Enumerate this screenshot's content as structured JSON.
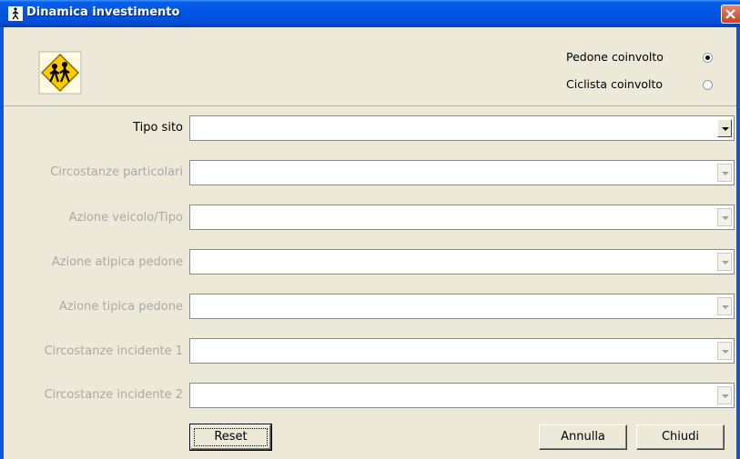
{
  "window": {
    "title": "Dinamica investimento"
  },
  "involvement": {
    "pedestrian": {
      "label": "Pedone coinvolto",
      "selected": true
    },
    "cyclist": {
      "label": "Ciclista coinvolto",
      "selected": false
    }
  },
  "fields": [
    {
      "label": "Tipo sito",
      "value": "",
      "enabled": true
    },
    {
      "label": "Circostanze particolari",
      "value": "",
      "enabled": false
    },
    {
      "label": "Azione veicolo/Tipo",
      "value": "",
      "enabled": false
    },
    {
      "label": "Azione atipica pedone",
      "value": "",
      "enabled": false
    },
    {
      "label": "Azione tipica pedone",
      "value": "",
      "enabled": false
    },
    {
      "label": "Circostanze incidente 1",
      "value": "",
      "enabled": false
    },
    {
      "label": "Circostanze incidente 2",
      "value": "",
      "enabled": false
    }
  ],
  "buttons": {
    "reset": "Reset",
    "cancel": "Annulla",
    "close": "Chiudi"
  },
  "colors": {
    "title_bar": "#0054e3",
    "window_bg": "#ece9d8",
    "close_button": "#d9553b",
    "disabled_text": "#a9a9a9"
  }
}
